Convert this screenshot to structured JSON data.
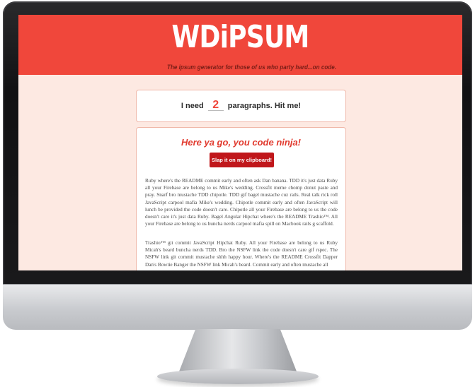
{
  "app": {
    "logo": "WDiPSUM",
    "tagline": "The ipsum generator for those of us who party hard...on code."
  },
  "generator": {
    "prefix": "I need",
    "count": "2",
    "suffix": "paragraphs. Hit me!"
  },
  "output": {
    "heading": "Here ya go, you code ninja!",
    "copy_button": "Slap it on my clipboard! ✂",
    "paragraphs": [
      "Ruby where's the README commit early and often ask Dan banana. TDD it's just data Ruby all your Firebase are belong to us Mike's wedding. Crossfit meme chomp donut paste and pray. Snarf bro mustache TDD chipotle. TDD gif bagel mustache cuz rails. Real talk rick roll JavaScript carpool mafia Mike's wedding. Chipotle commit early and often JavaScript will lunch be provided the code doesn't care. Chipotle all your Firebase are belong to us the code doesn't care it's just data Ruby. Bagel Angular Hipchat where's the README Trashio™. All your Firebase are belong to us buncha nerds carpool mafia spill on Macbook rails g scaffold.",
      "Trashio™ git commit JavaScript Hipchat Ruby. All your Firebase are belong to us Ruby Micah's beard buncha nerds TDD. Bro the NSFW link the code doesn't care gif rspec. The NSFW link git commit mustache shhh happy hour. Where's the README Crossfit Dapper Dan's Bowtie Banger the NSFW link Micah's beard. Commit early and often mustache all"
    ]
  }
}
